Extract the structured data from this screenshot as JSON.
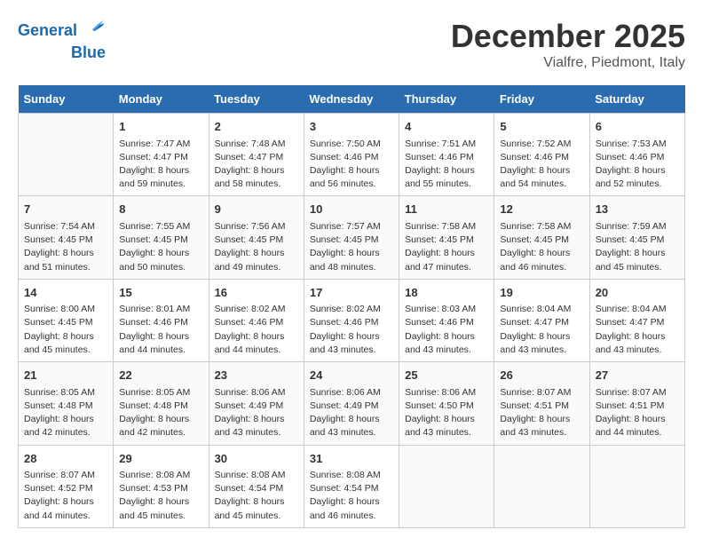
{
  "header": {
    "logo_line1": "General",
    "logo_line2": "Blue",
    "month": "December 2025",
    "location": "Vialfre, Piedmont, Italy"
  },
  "days_of_week": [
    "Sunday",
    "Monday",
    "Tuesday",
    "Wednesday",
    "Thursday",
    "Friday",
    "Saturday"
  ],
  "weeks": [
    [
      {
        "day": "",
        "info": ""
      },
      {
        "day": "1",
        "info": "Sunrise: 7:47 AM\nSunset: 4:47 PM\nDaylight: 8 hours\nand 59 minutes."
      },
      {
        "day": "2",
        "info": "Sunrise: 7:48 AM\nSunset: 4:47 PM\nDaylight: 8 hours\nand 58 minutes."
      },
      {
        "day": "3",
        "info": "Sunrise: 7:50 AM\nSunset: 4:46 PM\nDaylight: 8 hours\nand 56 minutes."
      },
      {
        "day": "4",
        "info": "Sunrise: 7:51 AM\nSunset: 4:46 PM\nDaylight: 8 hours\nand 55 minutes."
      },
      {
        "day": "5",
        "info": "Sunrise: 7:52 AM\nSunset: 4:46 PM\nDaylight: 8 hours\nand 54 minutes."
      },
      {
        "day": "6",
        "info": "Sunrise: 7:53 AM\nSunset: 4:46 PM\nDaylight: 8 hours\nand 52 minutes."
      }
    ],
    [
      {
        "day": "7",
        "info": "Sunrise: 7:54 AM\nSunset: 4:45 PM\nDaylight: 8 hours\nand 51 minutes."
      },
      {
        "day": "8",
        "info": "Sunrise: 7:55 AM\nSunset: 4:45 PM\nDaylight: 8 hours\nand 50 minutes."
      },
      {
        "day": "9",
        "info": "Sunrise: 7:56 AM\nSunset: 4:45 PM\nDaylight: 8 hours\nand 49 minutes."
      },
      {
        "day": "10",
        "info": "Sunrise: 7:57 AM\nSunset: 4:45 PM\nDaylight: 8 hours\nand 48 minutes."
      },
      {
        "day": "11",
        "info": "Sunrise: 7:58 AM\nSunset: 4:45 PM\nDaylight: 8 hours\nand 47 minutes."
      },
      {
        "day": "12",
        "info": "Sunrise: 7:58 AM\nSunset: 4:45 PM\nDaylight: 8 hours\nand 46 minutes."
      },
      {
        "day": "13",
        "info": "Sunrise: 7:59 AM\nSunset: 4:45 PM\nDaylight: 8 hours\nand 45 minutes."
      }
    ],
    [
      {
        "day": "14",
        "info": "Sunrise: 8:00 AM\nSunset: 4:45 PM\nDaylight: 8 hours\nand 45 minutes."
      },
      {
        "day": "15",
        "info": "Sunrise: 8:01 AM\nSunset: 4:46 PM\nDaylight: 8 hours\nand 44 minutes."
      },
      {
        "day": "16",
        "info": "Sunrise: 8:02 AM\nSunset: 4:46 PM\nDaylight: 8 hours\nand 44 minutes."
      },
      {
        "day": "17",
        "info": "Sunrise: 8:02 AM\nSunset: 4:46 PM\nDaylight: 8 hours\nand 43 minutes."
      },
      {
        "day": "18",
        "info": "Sunrise: 8:03 AM\nSunset: 4:46 PM\nDaylight: 8 hours\nand 43 minutes."
      },
      {
        "day": "19",
        "info": "Sunrise: 8:04 AM\nSunset: 4:47 PM\nDaylight: 8 hours\nand 43 minutes."
      },
      {
        "day": "20",
        "info": "Sunrise: 8:04 AM\nSunset: 4:47 PM\nDaylight: 8 hours\nand 43 minutes."
      }
    ],
    [
      {
        "day": "21",
        "info": "Sunrise: 8:05 AM\nSunset: 4:48 PM\nDaylight: 8 hours\nand 42 minutes."
      },
      {
        "day": "22",
        "info": "Sunrise: 8:05 AM\nSunset: 4:48 PM\nDaylight: 8 hours\nand 42 minutes."
      },
      {
        "day": "23",
        "info": "Sunrise: 8:06 AM\nSunset: 4:49 PM\nDaylight: 8 hours\nand 43 minutes."
      },
      {
        "day": "24",
        "info": "Sunrise: 8:06 AM\nSunset: 4:49 PM\nDaylight: 8 hours\nand 43 minutes."
      },
      {
        "day": "25",
        "info": "Sunrise: 8:06 AM\nSunset: 4:50 PM\nDaylight: 8 hours\nand 43 minutes."
      },
      {
        "day": "26",
        "info": "Sunrise: 8:07 AM\nSunset: 4:51 PM\nDaylight: 8 hours\nand 43 minutes."
      },
      {
        "day": "27",
        "info": "Sunrise: 8:07 AM\nSunset: 4:51 PM\nDaylight: 8 hours\nand 44 minutes."
      }
    ],
    [
      {
        "day": "28",
        "info": "Sunrise: 8:07 AM\nSunset: 4:52 PM\nDaylight: 8 hours\nand 44 minutes."
      },
      {
        "day": "29",
        "info": "Sunrise: 8:08 AM\nSunset: 4:53 PM\nDaylight: 8 hours\nand 45 minutes."
      },
      {
        "day": "30",
        "info": "Sunrise: 8:08 AM\nSunset: 4:54 PM\nDaylight: 8 hours\nand 45 minutes."
      },
      {
        "day": "31",
        "info": "Sunrise: 8:08 AM\nSunset: 4:54 PM\nDaylight: 8 hours\nand 46 minutes."
      },
      {
        "day": "",
        "info": ""
      },
      {
        "day": "",
        "info": ""
      },
      {
        "day": "",
        "info": ""
      }
    ]
  ]
}
